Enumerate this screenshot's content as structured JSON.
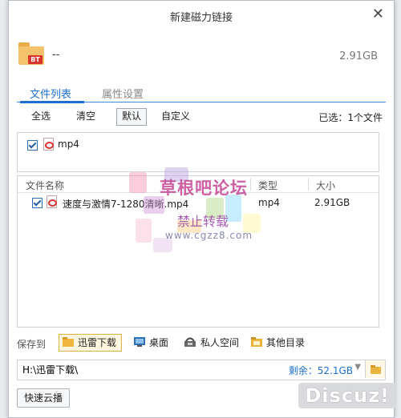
{
  "dialog": {
    "title": "新建磁力链接",
    "close_glyph": "✕"
  },
  "torrent": {
    "badge": "BT",
    "name": "--",
    "size": "2.91GB"
  },
  "tabs": [
    {
      "label": "文件列表",
      "active": true
    },
    {
      "label": "属性设置",
      "active": false
    }
  ],
  "filter": {
    "select_all": "全选",
    "clear": "清空",
    "default": "默认",
    "custom": "自定义",
    "selected_count": "已选：1个文件"
  },
  "types_box": {
    "items": [
      {
        "label": "mp4",
        "checked": true
      }
    ]
  },
  "file_list": {
    "headers": {
      "name": "文件名称",
      "type": "类型",
      "size": "大小"
    },
    "rows": [
      {
        "name": "速度与激情7-1280清晰.mp4",
        "type": "mp4",
        "size": "2.91GB",
        "checked": true
      }
    ]
  },
  "watermark": {
    "title": "草根吧论坛",
    "subtitle": "禁止转载",
    "url": "www.cgzz8.com"
  },
  "save_to": {
    "label": "保存到",
    "options": [
      {
        "label": "迅雷下载",
        "icon": "thunder-folder-icon",
        "selected": true
      },
      {
        "label": "桌面",
        "icon": "desktop-icon",
        "selected": false
      },
      {
        "label": "私人空间",
        "icon": "private-space-icon",
        "selected": false
      },
      {
        "label": "其他目录",
        "icon": "folder-icon",
        "selected": false
      }
    ]
  },
  "path": {
    "value": "H:\\迅雷下载\\",
    "free_space": "剩余：52.1GB"
  },
  "quick_cloud": "快速云播",
  "corner_logo": "Discuz!",
  "colors": {
    "accent": "#1c6fd0",
    "bt_badge": "#d9342b",
    "folder": "#f3c26b"
  }
}
